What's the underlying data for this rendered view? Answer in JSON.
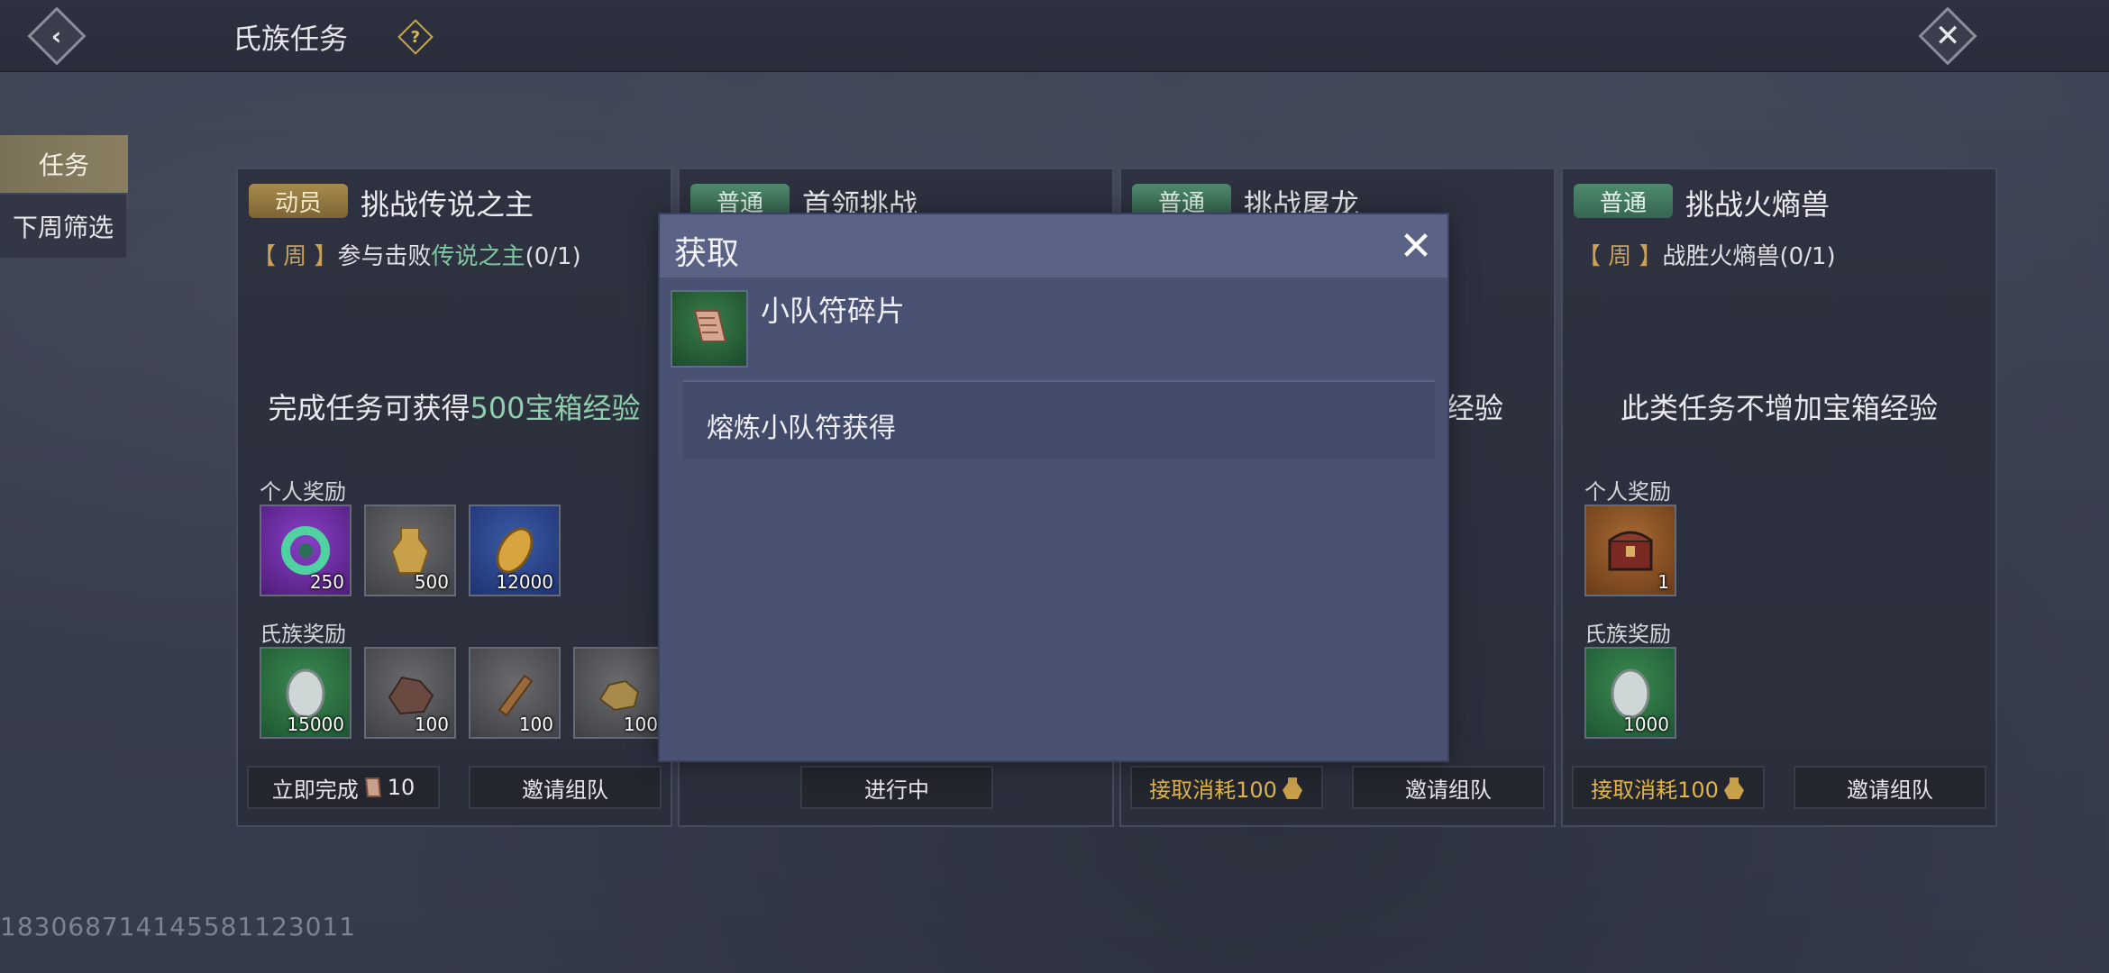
{
  "header": {
    "title": "氏族任务",
    "back_icon": "back-arrow-icon",
    "help_icon": "help-icon",
    "close_icon": "close-icon"
  },
  "sidebar": {
    "items": [
      {
        "label": "任务",
        "active": true
      },
      {
        "label": "下周筛选",
        "active": false
      }
    ]
  },
  "common": {
    "week_tag": "【 周 】",
    "personal_reward_label": "个人奖励",
    "clan_reward_label": "氏族奖励",
    "invite_label": "邀请组队"
  },
  "cards": [
    {
      "tag": "动员",
      "title": "挑战传说之主",
      "desc_prefix": "参与击败",
      "desc_target": "传说之主",
      "desc_progress": "(0/1)",
      "exp_prefix": "完成任务可获得",
      "exp_value": "500宝箱经验",
      "personal_rewards": [
        {
          "name": "jade-ring-icon",
          "qty": "250"
        },
        {
          "name": "spade-coin-icon",
          "qty": "500"
        },
        {
          "name": "shell-coin-icon",
          "qty": "12000"
        }
      ],
      "clan_rewards": [
        {
          "name": "silver-coin-icon",
          "qty": "15000"
        },
        {
          "name": "fur-pelt-icon",
          "qty": "100"
        },
        {
          "name": "wood-icon",
          "qty": "100"
        },
        {
          "name": "ore-icon",
          "qty": "100"
        }
      ],
      "btn_complete": "立即完成",
      "btn_complete_cost": "10"
    },
    {
      "tag": "普通",
      "title": "首领挑战",
      "btn_status": "进行中"
    },
    {
      "tag": "普通",
      "title": "挑战屠龙",
      "exp_tail": "经验",
      "btn_accept": "接取消耗100"
    },
    {
      "tag": "普通",
      "title": "挑战火熵兽",
      "desc": "战胜火熵兽(0/1)",
      "exp_text": "此类任务不增加宝箱经验",
      "personal_rewards": [
        {
          "name": "treasure-chest-icon",
          "qty": "1"
        }
      ],
      "clan_rewards": [
        {
          "name": "silver-coin-icon",
          "qty": "1000"
        }
      ],
      "btn_accept": "接取消耗100"
    }
  ],
  "popup": {
    "title": "获取",
    "item_name": "小队符碎片",
    "item_icon": "scroll-fragment-icon",
    "source": "熔炼小队符获得"
  },
  "footer": {
    "uid": "18306871414558112301​1"
  }
}
